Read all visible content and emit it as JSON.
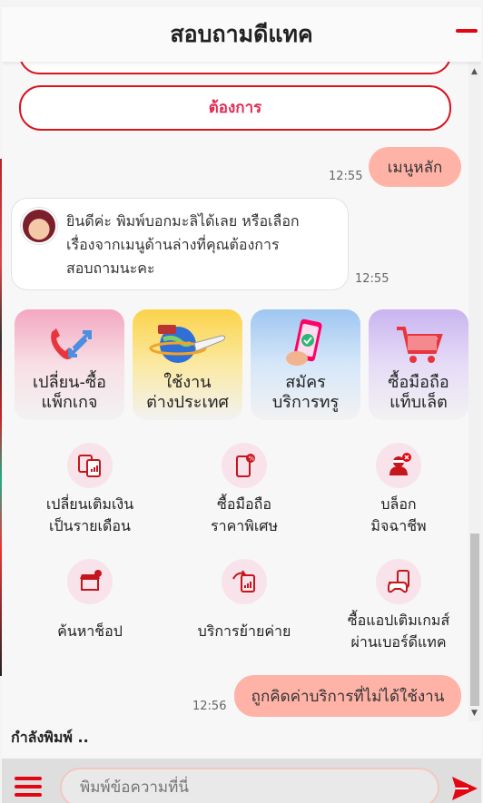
{
  "header": {
    "title": "สอบถามดีแทค"
  },
  "chat": {
    "want_button": "ต้องการ",
    "user_msg_1": {
      "text": "เมนูหลัก",
      "time": "12:55"
    },
    "bot_msg": {
      "lines": [
        "ยินดีค่ะ พิมพ์บอกมะลิได้เลย หรือเลือก",
        "เรื่องจากเมนูด้านล่างที่คุณต้องการ",
        "สอบถามนะคะ"
      ],
      "time": "12:55"
    },
    "cards": [
      {
        "line1": "เปลี่ยน-ซื้อ",
        "line2": "แพ็กเกจ",
        "icon": "phone-arrows-icon"
      },
      {
        "line1": "ใช้งาน",
        "line2": "ต่างประเทศ",
        "icon": "globe-plane-icon"
      },
      {
        "line1": "สมัคร",
        "line2": "บริการทรู",
        "icon": "phone-check-icon"
      },
      {
        "line1": "ซื้อมือถือ",
        "line2": "แท็บเล็ต",
        "icon": "cart-icon"
      }
    ],
    "services": [
      {
        "line1": "เปลี่ยนเติมเงิน",
        "line2": "เป็นรายเดือน",
        "icon": "sim-switch-icon"
      },
      {
        "line1": "ซื้อมือถือ",
        "line2": "ราคาพิเศษ",
        "icon": "phone-discount-icon"
      },
      {
        "line1": "บล็อก",
        "line2": "มิจฉาชีพ",
        "icon": "block-scammer-icon"
      },
      {
        "line1": "ค้นหาช็อป",
        "line2": "",
        "icon": "shop-location-icon"
      },
      {
        "line1": "บริการย้ายค่าย",
        "line2": "",
        "icon": "network-switch-icon"
      },
      {
        "line1": "ซื้อแอปเติมเกมส์",
        "line2": "ผ่านเบอร์ดีแทค",
        "icon": "game-topup-icon"
      }
    ],
    "user_msg_2": {
      "text": "ถูกคิดค่าบริการที่ไม่ได้ใช้งาน",
      "time": "12:56"
    }
  },
  "typing_indicator": "กำลังพิมพ์ ..",
  "composer": {
    "placeholder": "พิมพ์ข้อความที่นี่"
  },
  "colors": {
    "brand_red": "#e30613",
    "user_bubble": "#ffb3a7",
    "pink_text": "#e32b54"
  }
}
